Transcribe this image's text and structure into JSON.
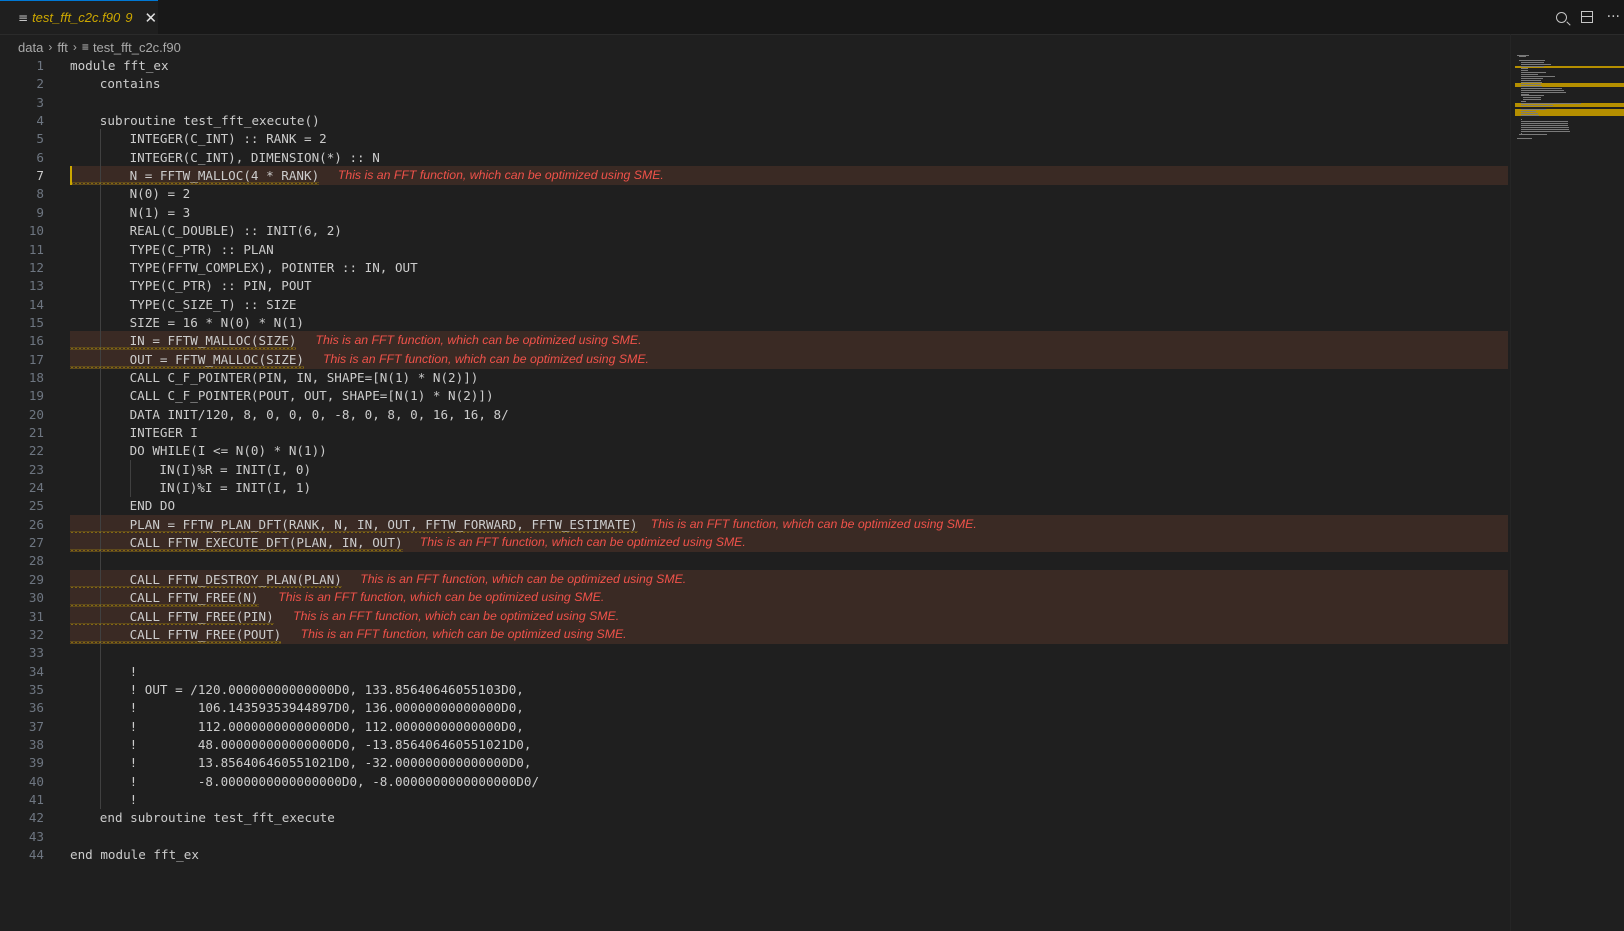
{
  "tab": {
    "file_icon": "hamburger-file-icon",
    "name": "test_fft_c2c.f90",
    "problem_count": "9",
    "close_glyph": "✕"
  },
  "actions": {
    "search_icon": "search-icon",
    "split_icon": "split-editor-icon",
    "more_glyph": "···"
  },
  "breadcrumb": {
    "items": [
      "data",
      "fft",
      "test_fft_c2c.f90"
    ],
    "separator": "›"
  },
  "editor": {
    "active_line": 7,
    "diagnostic": "This is an FFT function, which can be optimized using SME.",
    "lines": [
      {
        "n": "1",
        "text": "module fft_ex",
        "indent": 0
      },
      {
        "n": "2",
        "text": "contains",
        "indent": 1
      },
      {
        "n": "3",
        "text": "",
        "indent": 1
      },
      {
        "n": "4",
        "text": "subroutine test_fft_execute()",
        "indent": 1
      },
      {
        "n": "5",
        "text": "INTEGER(C_INT) :: RANK = 2",
        "indent": 2
      },
      {
        "n": "6",
        "text": "INTEGER(C_INT), DIMENSION(*) :: N",
        "indent": 2
      },
      {
        "n": "7",
        "text": "N = FFTW_MALLOC(4 * RANK)",
        "indent": 2,
        "warn": true
      },
      {
        "n": "8",
        "text": "N(0) = 2",
        "indent": 2
      },
      {
        "n": "9",
        "text": "N(1) = 3",
        "indent": 2
      },
      {
        "n": "10",
        "text": "REAL(C_DOUBLE) :: INIT(6, 2)",
        "indent": 2
      },
      {
        "n": "11",
        "text": "TYPE(C_PTR) :: PLAN",
        "indent": 2
      },
      {
        "n": "12",
        "text": "TYPE(FFTW_COMPLEX), POINTER :: IN, OUT",
        "indent": 2
      },
      {
        "n": "13",
        "text": "TYPE(C_PTR) :: PIN, POUT",
        "indent": 2
      },
      {
        "n": "14",
        "text": "TYPE(C_SIZE_T) :: SIZE",
        "indent": 2
      },
      {
        "n": "15",
        "text": "SIZE = 16 * N(0) * N(1)",
        "indent": 2
      },
      {
        "n": "16",
        "text": "IN = FFTW_MALLOC(SIZE)",
        "indent": 2,
        "warn": true
      },
      {
        "n": "17",
        "text": "OUT = FFTW_MALLOC(SIZE)",
        "indent": 2,
        "warn": true
      },
      {
        "n": "18",
        "text": "CALL C_F_POINTER(PIN, IN, SHAPE=[N(1) * N(2)])",
        "indent": 2
      },
      {
        "n": "19",
        "text": "CALL C_F_POINTER(POUT, OUT, SHAPE=[N(1) * N(2)])",
        "indent": 2
      },
      {
        "n": "20",
        "text": "DATA INIT/120, 8, 0, 0, 0, -8, 0, 8, 0, 16, 16, 8/",
        "indent": 2
      },
      {
        "n": "21",
        "text": "INTEGER I",
        "indent": 2
      },
      {
        "n": "22",
        "text": "DO WHILE(I <= N(0) * N(1))",
        "indent": 2
      },
      {
        "n": "23",
        "text": "IN(I)%R = INIT(I, 0)",
        "indent": 3
      },
      {
        "n": "24",
        "text": "IN(I)%I = INIT(I, 1)",
        "indent": 3
      },
      {
        "n": "25",
        "text": "END DO",
        "indent": 2
      },
      {
        "n": "26",
        "text": "PLAN = FFTW_PLAN_DFT(RANK, N, IN, OUT, FFTW_FORWARD, FFTW_ESTIMATE)",
        "indent": 2,
        "warn": true
      },
      {
        "n": "27",
        "text": "CALL FFTW_EXECUTE_DFT(PLAN, IN, OUT)",
        "indent": 2,
        "warn": true
      },
      {
        "n": "28",
        "text": "",
        "indent": 2
      },
      {
        "n": "29",
        "text": "CALL FFTW_DESTROY_PLAN(PLAN)",
        "indent": 2,
        "warn": true
      },
      {
        "n": "30",
        "text": "CALL FFTW_FREE(N)",
        "indent": 2,
        "warn": true
      },
      {
        "n": "31",
        "text": "CALL FFTW_FREE(PIN)",
        "indent": 2,
        "warn": true
      },
      {
        "n": "32",
        "text": "CALL FFTW_FREE(POUT)",
        "indent": 2,
        "warn": true
      },
      {
        "n": "33",
        "text": "",
        "indent": 2
      },
      {
        "n": "34",
        "text": "!",
        "indent": 2
      },
      {
        "n": "35",
        "text": "! OUT = /120.00000000000000D0, 133.85640646055103D0,",
        "indent": 2
      },
      {
        "n": "36",
        "text": "!        106.14359353944897D0, 136.00000000000000D0,",
        "indent": 2
      },
      {
        "n": "37",
        "text": "!        112.00000000000000D0, 112.00000000000000D0,",
        "indent": 2
      },
      {
        "n": "38",
        "text": "!        48.000000000000000D0, -13.856406460551021D0,",
        "indent": 2
      },
      {
        "n": "39",
        "text": "!        13.856406460551021D0, -32.000000000000000D0,",
        "indent": 2
      },
      {
        "n": "40",
        "text": "!        -8.0000000000000000D0, -8.0000000000000000D0/",
        "indent": 2
      },
      {
        "n": "41",
        "text": "!",
        "indent": 2
      },
      {
        "n": "42",
        "text": "end subroutine test_fft_execute",
        "indent": 1
      },
      {
        "n": "43",
        "text": "",
        "indent": 0
      },
      {
        "n": "44",
        "text": "end module fft_ex",
        "indent": 0
      }
    ]
  }
}
